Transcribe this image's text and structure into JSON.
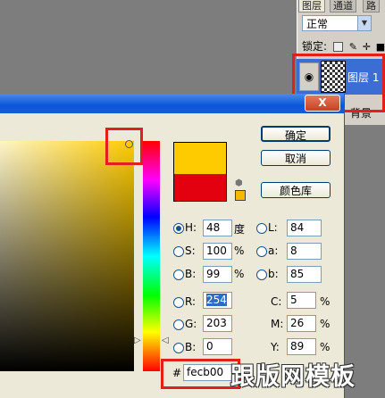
{
  "layers_panel": {
    "tabs": [
      "图层",
      "通道",
      "路"
    ],
    "blend_mode": "正常",
    "lock_label": "锁定:",
    "layer_name": "图层 1",
    "background_label": "背景"
  },
  "dialog": {
    "close_label": "X",
    "buttons": {
      "ok": "确定",
      "cancel": "取消",
      "libraries": "颜色库"
    },
    "fields": {
      "H": {
        "label": "H:",
        "value": "48",
        "unit": "度"
      },
      "S": {
        "label": "S:",
        "value": "100",
        "unit": "%"
      },
      "B": {
        "label": "B:",
        "value": "99",
        "unit": "%"
      },
      "R": {
        "label": "R:",
        "value": "254"
      },
      "G": {
        "label": "G:",
        "value": "203"
      },
      "Bl": {
        "label": "B:",
        "value": "0"
      },
      "L": {
        "label": "L:",
        "value": "84"
      },
      "a": {
        "label": "a:",
        "value": "8"
      },
      "b": {
        "label": "b:",
        "value": "85"
      },
      "C": {
        "label": "C:",
        "value": "5",
        "unit": "%"
      },
      "M": {
        "label": "M:",
        "value": "26",
        "unit": "%"
      },
      "Y": {
        "label": "Y:",
        "value": "89",
        "unit": "%"
      }
    },
    "hex": {
      "label": "#",
      "value": "fecb00"
    },
    "colors": {
      "new": "#fecb00",
      "old": "#e3000f",
      "highlight": "#e1201c"
    }
  },
  "watermark": "跟版网模板"
}
